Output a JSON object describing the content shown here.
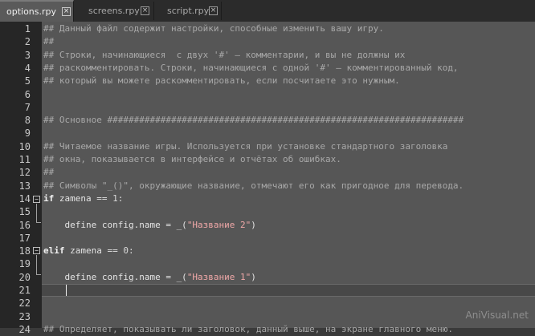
{
  "tabs": [
    {
      "label": "options.rpy",
      "active": true
    },
    {
      "label": "screens.rpy",
      "active": false
    },
    {
      "label": "script.rpy",
      "active": false
    }
  ],
  "close_glyph": "×",
  "fold_glyph": "−",
  "lines": [
    {
      "n": "1",
      "segments": [
        {
          "t": "## Данный файл содержит настройки, способные изменить вашу игру.",
          "c": "cmt"
        }
      ]
    },
    {
      "n": "2",
      "segments": [
        {
          "t": "##",
          "c": "cmt"
        }
      ]
    },
    {
      "n": "3",
      "segments": [
        {
          "t": "## Строки, начинающиеся  с двух '#' — комментарии, и вы не должны их",
          "c": "cmt"
        }
      ]
    },
    {
      "n": "4",
      "segments": [
        {
          "t": "## раскомментировать. Строки, начинающиеся с одной '#' — комментированный код,",
          "c": "cmt"
        }
      ]
    },
    {
      "n": "5",
      "segments": [
        {
          "t": "## который вы можете раскомментировать, если посчитаете это нужным.",
          "c": "cmt"
        }
      ]
    },
    {
      "n": "6",
      "segments": []
    },
    {
      "n": "7",
      "segments": []
    },
    {
      "n": "8",
      "segments": [
        {
          "t": "## Основное ###################################################################",
          "c": "cmt"
        }
      ]
    },
    {
      "n": "9",
      "segments": []
    },
    {
      "n": "10",
      "segments": [
        {
          "t": "## Читаемое название игры. Используется при установке стандартного заголовка",
          "c": "cmt"
        }
      ]
    },
    {
      "n": "11",
      "segments": [
        {
          "t": "## окна, показывается в интерфейсе и отчётах об ошибках.",
          "c": "cmt"
        }
      ]
    },
    {
      "n": "12",
      "segments": [
        {
          "t": "##",
          "c": "cmt"
        }
      ]
    },
    {
      "n": "13",
      "segments": [
        {
          "t": "## Символы \"_()\", окружающие название, отмечают его как пригодное для перевода.",
          "c": "cmt"
        }
      ]
    },
    {
      "n": "14",
      "segments": [
        {
          "t": "if",
          "c": "kw"
        },
        {
          "t": " zamena ",
          "c": "txt"
        },
        {
          "t": "==",
          "c": "op"
        },
        {
          "t": " 1:",
          "c": "num"
        }
      ]
    },
    {
      "n": "15",
      "segments": []
    },
    {
      "n": "16",
      "segments": [
        {
          "t": "    define config.name = _(",
          "c": "txt"
        },
        {
          "t": "\"Название 2\"",
          "c": "str"
        },
        {
          "t": ")",
          "c": "txt"
        }
      ]
    },
    {
      "n": "17",
      "segments": []
    },
    {
      "n": "18",
      "segments": [
        {
          "t": "elif",
          "c": "kw"
        },
        {
          "t": " zamena ",
          "c": "txt"
        },
        {
          "t": "==",
          "c": "op"
        },
        {
          "t": " 0:",
          "c": "num"
        }
      ]
    },
    {
      "n": "19",
      "segments": []
    },
    {
      "n": "20",
      "segments": [
        {
          "t": "    define config.name = _(",
          "c": "txt"
        },
        {
          "t": "\"Название 1\"",
          "c": "str"
        },
        {
          "t": ")",
          "c": "txt"
        }
      ]
    },
    {
      "n": "21",
      "segments": []
    },
    {
      "n": "22",
      "segments": []
    },
    {
      "n": "23",
      "segments": []
    },
    {
      "n": "24",
      "segments": [
        {
          "t": "## Определяет, показывать ли заголовок, данный выше, на экране главного меню.",
          "c": "cmt"
        }
      ]
    }
  ],
  "watermark": "AniVisual.net"
}
